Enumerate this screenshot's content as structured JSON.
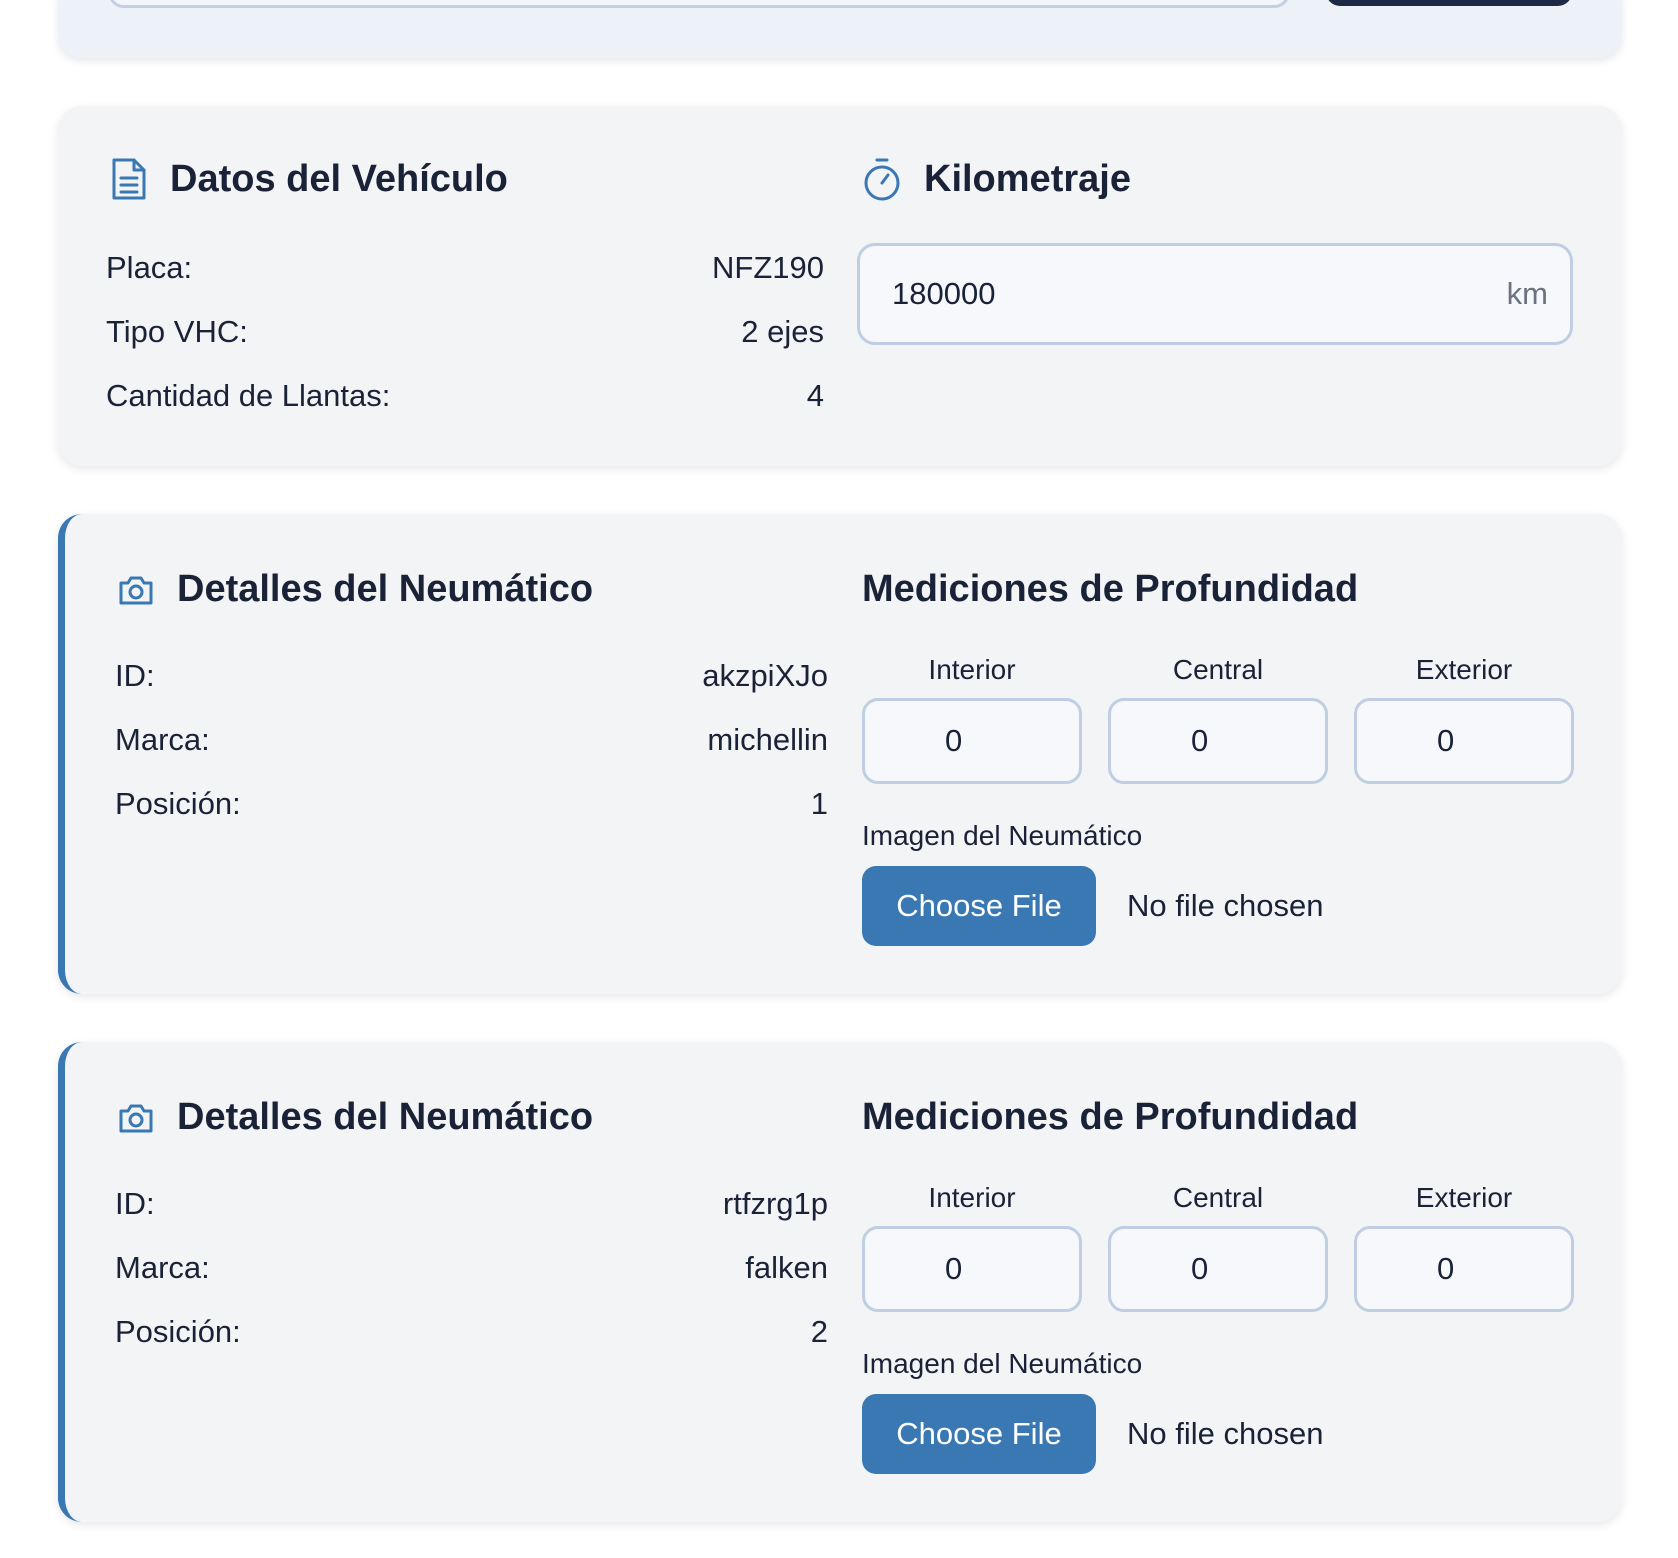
{
  "vehicle": {
    "title": "Datos del Vehículo",
    "rows": [
      {
        "label": "Placa:",
        "value": "NFZ190"
      },
      {
        "label": "Tipo VHC:",
        "value": "2 ejes"
      },
      {
        "label": "Cantidad de Llantas:",
        "value": "4"
      }
    ]
  },
  "mileage": {
    "title": "Kilometraje",
    "value": "180000",
    "unit": "km"
  },
  "tires": [
    {
      "title": "Detalles del Neumático",
      "rows": [
        {
          "label": "ID:",
          "value": "akzpiXJo"
        },
        {
          "label": "Marca:",
          "value": "michellin"
        },
        {
          "label": "Posición:",
          "value": "1"
        }
      ],
      "depth_title": "Mediciones de Profundidad",
      "depth_labels": [
        "Interior",
        "Central",
        "Exterior"
      ],
      "depth_values": [
        "0",
        "0",
        "0"
      ],
      "image_label": "Imagen del Neumático",
      "choose_label": "Choose File",
      "file_status": "No file chosen"
    },
    {
      "title": "Detalles del Neumático",
      "rows": [
        {
          "label": "ID:",
          "value": "rtfzrg1p"
        },
        {
          "label": "Marca:",
          "value": "falken"
        },
        {
          "label": "Posición:",
          "value": "2"
        }
      ],
      "depth_title": "Mediciones de Profundidad",
      "depth_labels": [
        "Interior",
        "Central",
        "Exterior"
      ],
      "depth_values": [
        "0",
        "0",
        "0"
      ],
      "image_label": "Imagen del Neumático",
      "choose_label": "Choose File",
      "file_status": "No file chosen"
    }
  ],
  "colors": {
    "accent": "#3a78b4",
    "card_bg": "#f3f4f6",
    "text": "#1a2238",
    "input_border": "#bfcee2"
  },
  "icons": {
    "vehicle": "document-icon",
    "mileage": "stopwatch-icon",
    "tire": "camera-icon"
  }
}
